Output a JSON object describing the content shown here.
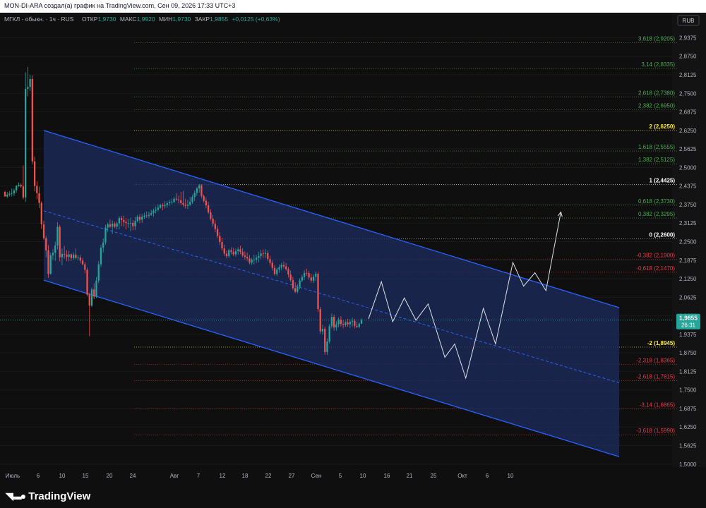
{
  "header": {
    "title": "MON-DI-ARA создал(а) график на TradingView.com, Сен 09, 2026 17:33 UTC+3"
  },
  "legend": {
    "symbol": "МГКЛ - обыкн. · 1ч · RUS",
    "open_label": "ОТКР",
    "open": "1,9730",
    "high_label": "МАКС",
    "high": "1,9920",
    "low_label": "МИН",
    "low": "1,9730",
    "close_label": "ЗАКР",
    "close": "1,9855",
    "change": "+0,0125 (+0,63%)"
  },
  "currency_badge": "RUB",
  "price_badge": {
    "price": "1,9855",
    "timer": "26:31"
  },
  "brand": {
    "logo_text": "TradingView"
  },
  "colors": {
    "up": "#26a69a",
    "down": "#ef5350",
    "channel": "#2962ff",
    "channel_fill": "#1c2c5e",
    "fib_pos": "#4caf50",
    "fib_neg": "#f23645",
    "fib_key": "#ffffff",
    "fib_two": "#ffeb3b"
  },
  "chart_data": {
    "type": "candlestick",
    "y_axis": {
      "ticks": [
        "2,9375",
        "2,8750",
        "2,8125",
        "2,7500",
        "2,6875",
        "2,6250",
        "2,5625",
        "2,5000",
        "2,4375",
        "2,3750",
        "2,3125",
        "2,2500",
        "2,1875",
        "2,1250",
        "2,0625",
        "2,0000",
        "1,9375",
        "1,8750",
        "1,8125",
        "1,7500",
        "1,6875",
        "1,6250",
        "1,5625",
        "1,5000"
      ],
      "range": [
        1.49,
        2.96
      ]
    },
    "x_axis": {
      "ticks": [
        "Июль",
        "6",
        "10",
        "15",
        "20",
        "24",
        "Авг",
        "7",
        "12",
        "18",
        "22",
        "27",
        "Сен",
        "5",
        "10",
        "16",
        "21",
        "25",
        "Окт",
        "6",
        "10"
      ]
    },
    "last_price": 1.9855,
    "fib_levels": [
      {
        "label": "3,618 (2,9205)",
        "value": 2.9205,
        "kind": "pos"
      },
      {
        "label": "3,14 (2,8335)",
        "value": 2.8335,
        "kind": "pos"
      },
      {
        "label": "2,618 (2,7380)",
        "value": 2.738,
        "kind": "pos"
      },
      {
        "label": "2,382 (2,6950)",
        "value": 2.695,
        "kind": "pos"
      },
      {
        "label": "2 (2,6250)",
        "value": 2.625,
        "kind": "two"
      },
      {
        "label": "1,618 (2,5555)",
        "value": 2.5555,
        "kind": "pos"
      },
      {
        "label": "1,382 (2,5125)",
        "value": 2.5125,
        "kind": "pos"
      },
      {
        "label": "1 (2,4425)",
        "value": 2.4425,
        "kind": "key"
      },
      {
        "label": "0,618 (2,3730)",
        "value": 2.373,
        "kind": "pos"
      },
      {
        "label": "0,382 (2,3295)",
        "value": 2.3295,
        "kind": "pos"
      },
      {
        "label": "0 (2,2600)",
        "value": 2.26,
        "kind": "key"
      },
      {
        "label": "-0,382 (2,1900)",
        "value": 2.19,
        "kind": "neg"
      },
      {
        "label": "-0,618 (2,1470)",
        "value": 2.147,
        "kind": "neg"
      },
      {
        "label": "-2 (1,8945)",
        "value": 1.8945,
        "kind": "two"
      },
      {
        "label": "-2,318 (1,8365)",
        "value": 1.8365,
        "kind": "neg"
      },
      {
        "label": "-2,618 (1,7815)",
        "value": 1.7815,
        "kind": "neg"
      },
      {
        "label": "-3,14 (1,6865)",
        "value": 1.6865,
        "kind": "neg"
      },
      {
        "label": "-3,618 (1,5990)",
        "value": 1.599,
        "kind": "neg"
      }
    ],
    "channel": {
      "upper": [
        [
          0.0,
          2.625
        ],
        [
          1.0,
          2.0275
        ]
      ],
      "middle": [
        [
          0.0,
          2.354
        ],
        [
          1.0,
          1.774
        ]
      ],
      "lower": [
        [
          0.0,
          2.12
        ],
        [
          1.0,
          1.525
        ]
      ]
    },
    "forecast_path": [
      [
        0.0,
        1.99
      ],
      [
        0.043,
        2.115
      ],
      [
        0.081,
        1.98
      ],
      [
        0.12,
        2.06
      ],
      [
        0.159,
        1.985
      ],
      [
        0.2,
        2.04
      ],
      [
        0.256,
        1.86
      ],
      [
        0.289,
        1.905
      ],
      [
        0.326,
        1.79
      ],
      [
        0.385,
        2.025
      ],
      [
        0.426,
        1.905
      ],
      [
        0.484,
        2.18
      ],
      [
        0.52,
        2.1
      ],
      [
        0.558,
        2.145
      ],
      [
        0.595,
        2.085
      ],
      [
        0.645,
        2.35
      ]
    ],
    "candles": [
      [
        2.4175,
        2.4214,
        2.4014,
        2.4023
      ],
      [
        2.4023,
        2.418,
        2.3976,
        2.4082
      ],
      [
        2.4082,
        2.4199,
        2.4023,
        2.4116
      ],
      [
        2.4116,
        2.4288,
        2.4024,
        2.4125
      ],
      [
        2.4125,
        2.4291,
        2.4033,
        2.4228
      ],
      [
        2.4228,
        2.4406,
        2.4154,
        2.4376
      ],
      [
        2.4376,
        2.4496,
        2.4349,
        2.4416
      ],
      [
        2.4416,
        2.4466,
        2.4317,
        2.436
      ],
      [
        2.436,
        2.5067,
        2.3927,
        2.3992
      ],
      [
        2.3992,
        2.8209,
        2.3843,
        2.7648
      ],
      [
        2.7648,
        2.8387,
        2.7398,
        2.7713
      ],
      [
        2.7713,
        2.8119,
        2.7575,
        2.7982
      ],
      [
        2.7982,
        2.8104,
        2.5104,
        2.5205
      ],
      [
        2.5205,
        2.5368,
        2.4196,
        2.4379
      ],
      [
        2.4379,
        2.4524,
        2.3929,
        2.4131
      ],
      [
        2.4131,
        2.4348,
        2.3633,
        2.3804
      ],
      [
        2.3804,
        2.3862,
        2.2929,
        2.3081
      ],
      [
        2.3081,
        2.321,
        2.2563,
        2.2616
      ],
      [
        2.2616,
        2.2692,
        2.1979,
        2.2208
      ],
      [
        2.2208,
        2.2385,
        2.1286,
        2.1413
      ],
      [
        2.1413,
        2.2128,
        2.1388,
        2.2042
      ],
      [
        2.2042,
        2.2245,
        2.1889,
        2.2123
      ],
      [
        2.2123,
        2.2497,
        2.1859,
        2.2373
      ],
      [
        2.2373,
        2.3157,
        2.2242,
        2.2999
      ],
      [
        2.2999,
        2.3063,
        2.1833,
        2.1971
      ],
      [
        2.1971,
        2.2268,
        2.1697,
        2.2088
      ],
      [
        2.2088,
        2.2353,
        2.1925,
        2.2064
      ],
      [
        2.2064,
        2.2204,
        2.185,
        2.1986
      ],
      [
        2.1986,
        2.2191,
        2.1834,
        2.2072
      ],
      [
        2.2072,
        2.2104,
        2.1848,
        2.1945
      ],
      [
        2.1945,
        2.2136,
        2.1887,
        2.2063
      ],
      [
        2.2063,
        2.2266,
        2.1909,
        2.1945
      ],
      [
        2.1945,
        2.2046,
        2.1864,
        2.1962
      ],
      [
        2.1962,
        2.205,
        2.1771,
        2.1861
      ],
      [
        2.1861,
        2.1949,
        2.1701,
        2.1736
      ],
      [
        2.1736,
        2.1811,
        2.1432,
        2.1548
      ],
      [
        2.1548,
        2.1626,
        2.0658,
        2.071
      ],
      [
        2.071,
        2.0773,
        1.9312,
        2.0343
      ],
      [
        2.0343,
        2.0956,
        2.0297,
        2.089
      ],
      [
        2.089,
        2.1097,
        2.0564,
        2.0646
      ],
      [
        2.0646,
        2.1307,
        2.0602,
        2.1186
      ],
      [
        2.1186,
        2.1839,
        2.1103,
        2.1735
      ],
      [
        2.1735,
        2.2392,
        2.1644,
        2.2298
      ],
      [
        2.2298,
        2.2609,
        2.2129,
        2.2474
      ],
      [
        2.2474,
        2.3065,
        2.2393,
        2.2975
      ],
      [
        2.2975,
        2.3141,
        2.2828,
        2.3083
      ],
      [
        2.3083,
        2.3254,
        2.2965,
        2.3003
      ],
      [
        2.3003,
        2.3212,
        2.2763,
        2.3105
      ],
      [
        2.3105,
        2.3167,
        2.2958,
        2.3002
      ],
      [
        2.3002,
        2.3178,
        2.2912,
        2.3119
      ],
      [
        2.3119,
        2.3358,
        2.2912,
        2.3297
      ],
      [
        2.3297,
        2.3368,
        2.3022,
        2.3224
      ],
      [
        2.3224,
        2.3376,
        2.301,
        2.316
      ],
      [
        2.316,
        2.3293,
        2.2913,
        2.3124
      ],
      [
        2.3124,
        2.3266,
        2.2964,
        2.3129
      ],
      [
        2.3129,
        2.3318,
        2.2845,
        2.3132
      ],
      [
        2.3132,
        2.3223,
        2.2884,
        2.3018
      ],
      [
        2.3018,
        2.3339,
        2.2894,
        2.3196
      ],
      [
        2.3196,
        2.3401,
        2.3148,
        2.3338
      ],
      [
        2.3338,
        2.3426,
        2.3122,
        2.3238
      ],
      [
        2.3238,
        2.3442,
        2.3131,
        2.3339
      ],
      [
        2.3339,
        2.3474,
        2.3268,
        2.3377
      ],
      [
        2.3377,
        2.3518,
        2.3296,
        2.3369
      ],
      [
        2.3369,
        2.3517,
        2.3289,
        2.3404
      ],
      [
        2.3404,
        2.3575,
        2.3369,
        2.3465
      ],
      [
        2.3465,
        2.3617,
        2.3343,
        2.3548
      ],
      [
        2.3548,
        2.3683,
        2.3447,
        2.3575
      ],
      [
        2.3575,
        2.3766,
        2.3518,
        2.3645
      ],
      [
        2.3645,
        2.3777,
        2.3615,
        2.3736
      ],
      [
        2.3736,
        2.3796,
        2.3556,
        2.3698
      ],
      [
        2.3698,
        2.3868,
        2.3618,
        2.3737
      ],
      [
        2.3737,
        2.3874,
        2.3639,
        2.3795
      ],
      [
        2.3795,
        2.3905,
        2.3707,
        2.3833
      ],
      [
        2.3833,
        2.3948,
        2.3764,
        2.3841
      ],
      [
        2.3841,
        2.4006,
        2.3796,
        2.3945
      ],
      [
        2.3945,
        2.4135,
        2.3872,
        2.3919
      ],
      [
        2.3919,
        2.4051,
        2.3788,
        2.3897
      ],
      [
        2.3897,
        2.4182,
        2.3736,
        2.3801
      ],
      [
        2.3801,
        2.4211,
        2.368,
        2.3744
      ],
      [
        2.3744,
        2.3945,
        2.3616,
        2.3709
      ],
      [
        2.3709,
        2.3905,
        2.36,
        2.3747
      ],
      [
        2.3747,
        2.4008,
        2.3704,
        2.3836
      ],
      [
        2.3836,
        2.4074,
        2.3771,
        2.4005
      ],
      [
        2.4005,
        2.4223,
        2.3871,
        2.4141
      ],
      [
        2.4141,
        2.4344,
        2.4049,
        2.4295
      ],
      [
        2.4295,
        2.4445,
        2.415,
        2.4398
      ],
      [
        2.4398,
        2.4436,
        2.3972,
        2.4037
      ],
      [
        2.4037,
        2.4086,
        2.3824,
        2.3876
      ],
      [
        2.3876,
        2.3992,
        2.3625,
        2.3725
      ],
      [
        2.3725,
        2.3844,
        2.3435,
        2.3492
      ],
      [
        2.3492,
        2.3596,
        2.3211,
        2.3275
      ],
      [
        2.3275,
        2.3397,
        2.3004,
        2.3099
      ],
      [
        2.3099,
        2.3227,
        2.2819,
        2.2925
      ],
      [
        2.2925,
        2.3042,
        2.2622,
        2.2694
      ],
      [
        2.2694,
        2.2818,
        2.2384,
        2.2489
      ],
      [
        2.2489,
        2.2635,
        2.2198,
        2.2269
      ],
      [
        2.2269,
        2.2393,
        2.2014,
        2.2096
      ],
      [
        2.2096,
        2.2201,
        2.1931,
        2.2011
      ],
      [
        2.2011,
        2.2258,
        2.194,
        2.2215
      ],
      [
        2.2215,
        2.2308,
        2.2073,
        2.2153
      ],
      [
        2.2153,
        2.2295,
        2.2011,
        2.2071
      ],
      [
        2.2071,
        2.2265,
        2.1993,
        2.2176
      ],
      [
        2.2176,
        2.2314,
        2.2063,
        2.2239
      ],
      [
        2.2239,
        2.2367,
        2.2075,
        2.2153
      ],
      [
        2.2153,
        2.2276,
        2.1976,
        2.2034
      ],
      [
        2.2034,
        2.2173,
        2.1898,
        2.1985
      ],
      [
        2.1985,
        2.2131,
        2.1858,
        2.1934
      ],
      [
        2.1934,
        2.2052,
        2.1735,
        2.1796
      ],
      [
        2.1796,
        2.1954,
        2.1715,
        2.1887
      ],
      [
        2.1887,
        2.2056,
        2.1736,
        2.1895
      ],
      [
        2.1895,
        2.2058,
        2.1787,
        2.1959
      ],
      [
        2.1959,
        2.2159,
        2.1803,
        2.2013
      ],
      [
        2.2013,
        2.2222,
        2.1909,
        2.2101
      ],
      [
        2.2101,
        2.2237,
        2.1945,
        2.2089
      ],
      [
        2.2089,
        2.2251,
        2.1952,
        2.2114
      ],
      [
        2.2114,
        2.2201,
        2.1842,
        2.1913
      ],
      [
        2.1913,
        2.2021,
        2.1698,
        2.1787
      ],
      [
        2.1787,
        2.1872,
        2.1522,
        2.1614
      ],
      [
        2.1614,
        2.1713,
        2.1358,
        2.1408
      ],
      [
        2.1408,
        2.1629,
        2.1337,
        2.1561
      ],
      [
        2.1561,
        2.1727,
        2.1452,
        2.1633
      ],
      [
        2.1633,
        2.1787,
        2.1528,
        2.1708
      ],
      [
        2.1708,
        2.1832,
        2.1595,
        2.1664
      ],
      [
        2.1664,
        2.1779,
        2.1522,
        2.1573
      ],
      [
        2.1573,
        2.1642,
        2.1293,
        2.1394
      ],
      [
        2.1394,
        2.1526,
        2.1142,
        2.1205
      ],
      [
        2.1205,
        2.1312,
        2.0874,
        2.0934
      ],
      [
        2.0934,
        2.1131,
        2.0765,
        2.0811
      ],
      [
        2.0811,
        2.1065,
        2.0759,
        2.0977
      ],
      [
        2.0977,
        2.1265,
        2.0899,
        2.1187
      ],
      [
        2.1187,
        2.1385,
        2.1129,
        2.1309
      ],
      [
        2.1309,
        2.1535,
        2.1199,
        2.1444
      ],
      [
        2.1444,
        2.1588,
        2.1348,
        2.1439
      ],
      [
        2.1439,
        2.1517,
        2.1217,
        2.1295
      ],
      [
        2.1295,
        2.1417,
        2.1113,
        2.1187
      ],
      [
        2.1187,
        2.1399,
        2.1102,
        2.1317
      ],
      [
        2.1317,
        2.1495,
        2.1178,
        2.1416
      ],
      [
        2.1416,
        2.1473,
        2.0128,
        2.0224
      ],
      [
        2.0224,
        2.0302,
        1.9396,
        1.9474
      ],
      [
        1.9474,
        1.9697,
        1.9365,
        1.9562
      ],
      [
        1.9562,
        1.9639,
        1.8693,
        1.8776
      ],
      [
        1.8776,
        1.9235,
        1.8675,
        1.9133
      ],
      [
        1.9133,
        1.9723,
        1.9071,
        1.9652
      ],
      [
        1.9652,
        2.0083,
        1.9574,
        1.9964
      ],
      [
        1.9964,
        2.0041,
        1.9493,
        1.9607
      ],
      [
        1.9607,
        1.9816,
        1.9497,
        1.9713
      ],
      [
        1.9713,
        1.9947,
        1.9611,
        1.9874
      ],
      [
        1.9874,
        1.9985,
        1.9634,
        1.9722
      ],
      [
        1.9722,
        1.9855,
        1.9576,
        1.9689
      ],
      [
        1.9689,
        1.9831,
        1.9623,
        1.9773
      ],
      [
        1.9773,
        1.9902,
        1.9633,
        1.9714
      ],
      [
        1.9714,
        1.9886,
        1.9592,
        1.9798
      ],
      [
        1.9798,
        1.9942,
        1.9637,
        1.9829
      ],
      [
        1.9829,
        1.9902,
        1.9579,
        1.9661
      ],
      [
        1.9661,
        1.9794,
        1.9588,
        1.9627
      ],
      [
        1.9627,
        1.9788,
        1.9591,
        1.973
      ],
      [
        1.973,
        1.992,
        1.973,
        1.9855
      ]
    ]
  }
}
